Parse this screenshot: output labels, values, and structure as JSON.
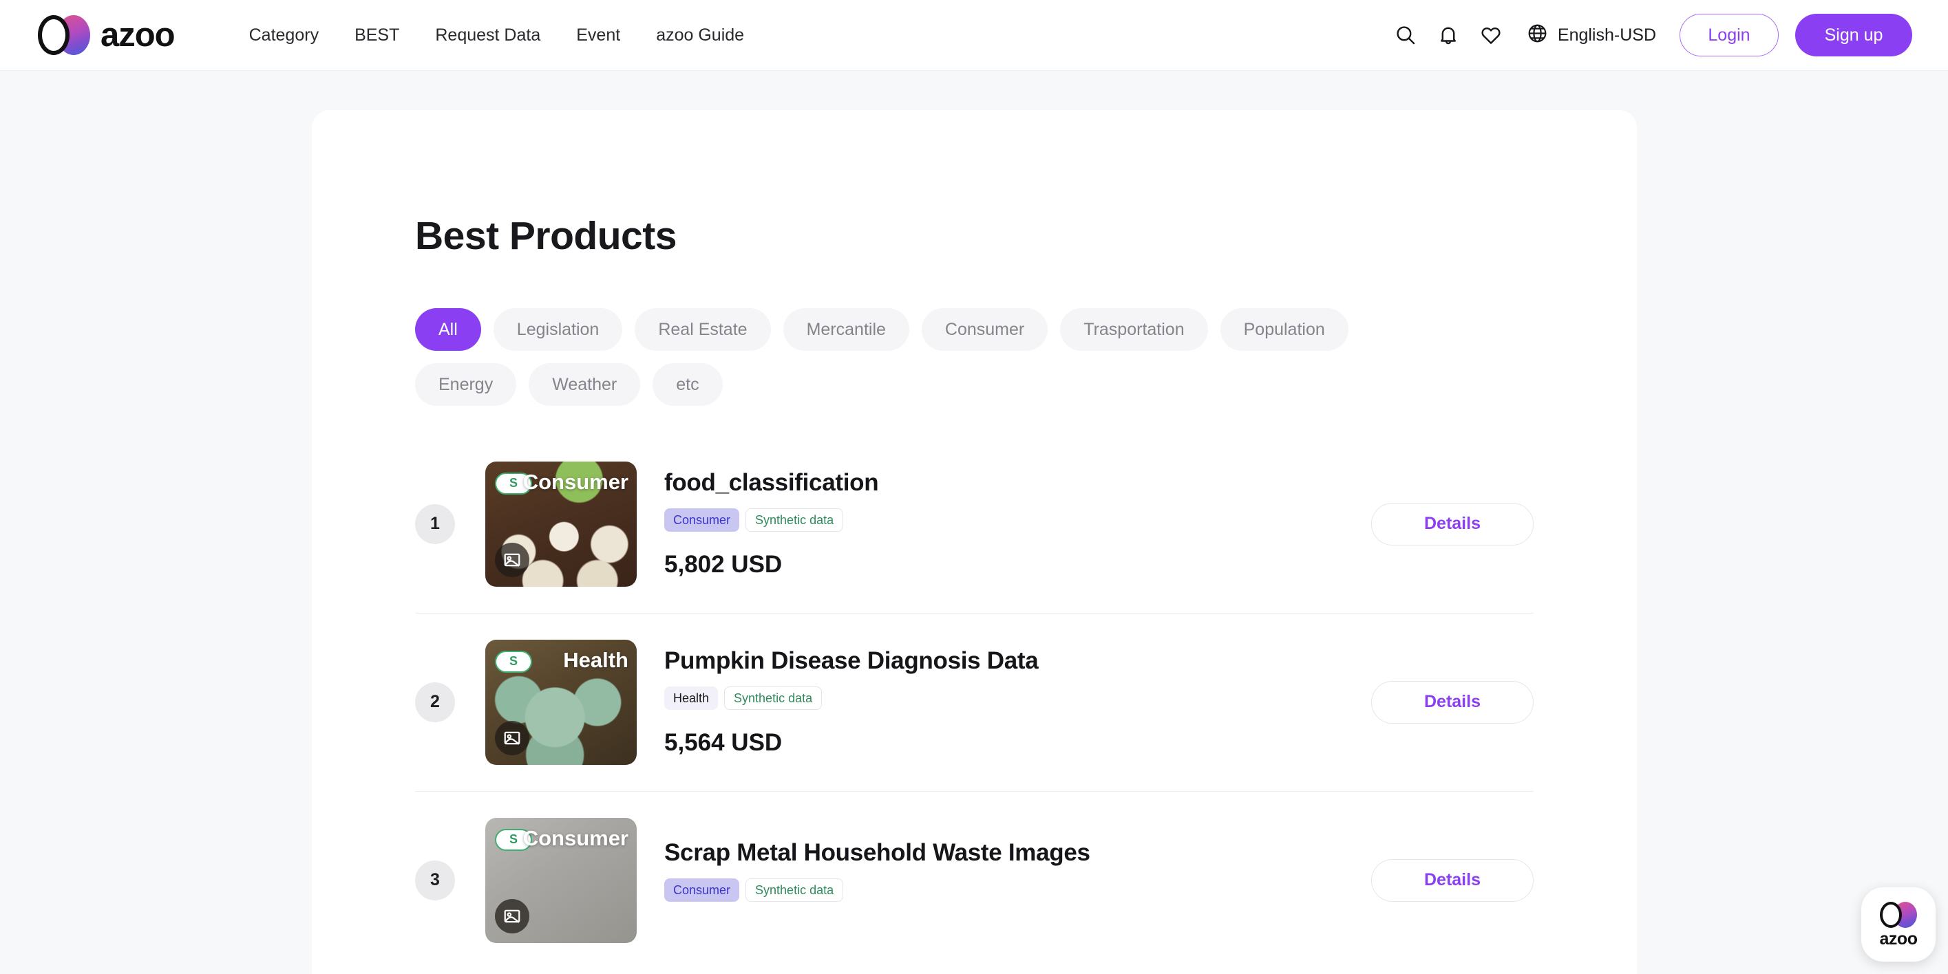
{
  "header": {
    "logo_text": "azoo",
    "nav": [
      {
        "label": "Category"
      },
      {
        "label": "BEST"
      },
      {
        "label": "Request Data"
      },
      {
        "label": "Event"
      },
      {
        "label": "azoo Guide"
      }
    ],
    "icons": {
      "search": "search-icon",
      "notification": "bell-icon",
      "wishlist": "heart-icon",
      "language": "globe-icon"
    },
    "language_label": "English-USD",
    "login_label": "Login",
    "signup_label": "Sign up"
  },
  "main": {
    "title": "Best Products",
    "filters": [
      {
        "label": "All",
        "active": true
      },
      {
        "label": "Legislation",
        "active": false
      },
      {
        "label": "Real Estate",
        "active": false
      },
      {
        "label": "Mercantile",
        "active": false
      },
      {
        "label": "Consumer",
        "active": false
      },
      {
        "label": "Trasportation",
        "active": false
      },
      {
        "label": "Population",
        "active": false
      },
      {
        "label": "Energy",
        "active": false
      },
      {
        "label": "Weather",
        "active": false
      },
      {
        "label": "etc",
        "active": false
      }
    ],
    "details_label": "Details",
    "products": [
      {
        "rank": "1",
        "name": "food_classification",
        "grade_badge": "S",
        "thumb_category": "Consumer",
        "category_tag": "Consumer",
        "data_tag": "Synthetic data",
        "price": "5,802 USD",
        "details_label": "Details",
        "media_icon": "image-icon"
      },
      {
        "rank": "2",
        "name": "Pumpkin Disease Diagnosis Data",
        "grade_badge": "S",
        "thumb_category": "Health",
        "category_tag": "Health",
        "data_tag": "Synthetic data",
        "price": "5,564 USD",
        "details_label": "Details",
        "media_icon": "image-icon"
      },
      {
        "rank": "3",
        "name": "Scrap Metal Household Waste Images",
        "grade_badge": "S",
        "thumb_category": "Consumer",
        "category_tag": "Consumer",
        "data_tag": "Synthetic data",
        "price": "",
        "details_label": "Details",
        "media_icon": "image-icon"
      }
    ]
  },
  "floating_button": {
    "label": "azoo"
  },
  "colors": {
    "brand_purple": "#8b3ff2",
    "page_background": "#f7f8fa",
    "card_background": "#ffffff",
    "green_accent": "#2f9b62",
    "tag_consumer_bg": "#c9c6f2",
    "tag_health_bg": "#f2f1f9"
  }
}
